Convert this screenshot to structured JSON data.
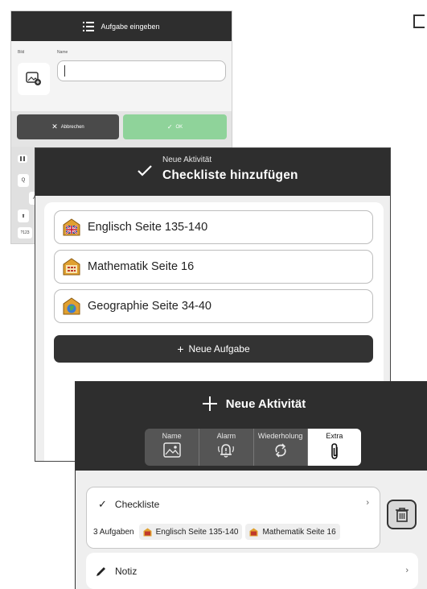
{
  "screen1": {
    "title": "Aufgabe eingeben",
    "bild_label": "Bild",
    "name_label": "Name",
    "cancel_label": "Abbrechen",
    "ok_label": "OK",
    "keyboard_keys": [
      "Q",
      "A",
      "?123"
    ]
  },
  "screen2": {
    "subtitle": "Neue Aktivität",
    "title": "Checkliste hinzufügen",
    "tasks": [
      {
        "label": "Englisch Seite 135-140",
        "icon": "english-book-icon"
      },
      {
        "label": "Mathematik Seite 16",
        "icon": "math-book-icon"
      },
      {
        "label": "Geographie Seite 34-40",
        "icon": "geography-book-icon"
      }
    ],
    "new_task_label": "Neue Aufgabe"
  },
  "screen3": {
    "title": "Neue Aktivität",
    "tabs": [
      {
        "label": "Name",
        "icon": "image-icon"
      },
      {
        "label": "Alarm",
        "icon": "alarm-icon"
      },
      {
        "label": "Wiederholung",
        "icon": "repeat-icon"
      },
      {
        "label": "Extra",
        "icon": "paperclip-icon"
      }
    ],
    "active_tab": "Extra",
    "checklist": {
      "label": "Checkliste",
      "count_label": "3 Aufgaben",
      "chips": [
        "Englisch Seite 135-140",
        "Mathematik Seite 16"
      ]
    },
    "note_label": "Notiz"
  },
  "colors": {
    "header_dark": "#2e2e2e",
    "ok_green": "#8fd39a",
    "cancel_gray": "#4a4a4a",
    "panel_bg": "#efefef"
  }
}
